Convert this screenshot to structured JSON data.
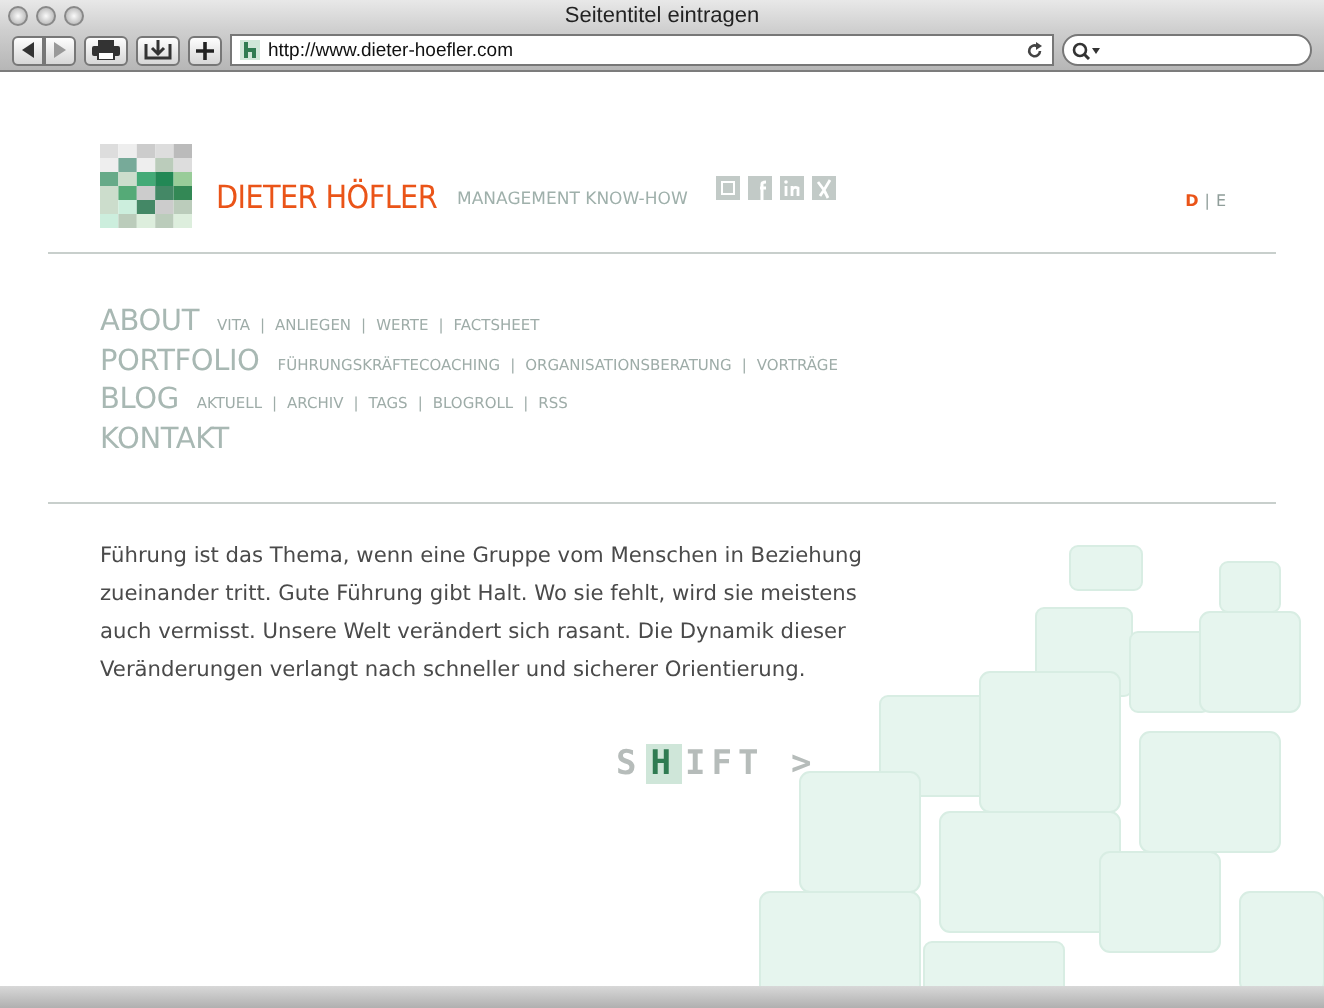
{
  "window": {
    "title": "Seitentitel eintragen"
  },
  "toolbar": {
    "url": "http://www.dieter-hoefler.com"
  },
  "header": {
    "name": "DIETER HÖFLER",
    "tagline": "MANAGEMENT KNOW-HOW"
  },
  "separator": "|",
  "languages": [
    {
      "label": "D",
      "selected": true
    },
    {
      "label": "E",
      "selected": false
    }
  ],
  "nav": [
    {
      "label": "ABOUT",
      "subitems": [
        "VITA",
        "ANLIEGEN",
        "WERTE",
        "FACTSHEET"
      ]
    },
    {
      "label": "PORTFOLIO",
      "subitems": [
        "FÜHRUNGSKRÄFTECOACHING",
        "ORGANISATIONSBERATUNG",
        "VORTRÄGE"
      ]
    },
    {
      "label": "BLOG",
      "subitems": [
        "AKTUELL",
        "ARCHIV",
        "TAGS",
        "BLOGROLL",
        "RSS"
      ]
    },
    {
      "label": "KONTAKT"
    }
  ],
  "intro": "Führung ist das Thema, wenn eine Gruppe vom Menschen in Beziehung zueinander tritt. Gute Führung gibt Halt. Wo sie fehlt, wird sie meistens auch vermisst. Unsere Welt verändert sich rasant. Die Dynamik dieser Veränderungen verlangt nach schneller und sicherer Orientierung.",
  "shift": {
    "before": "S",
    "highlight": "H",
    "after": "IFT",
    "arrow": ">"
  }
}
